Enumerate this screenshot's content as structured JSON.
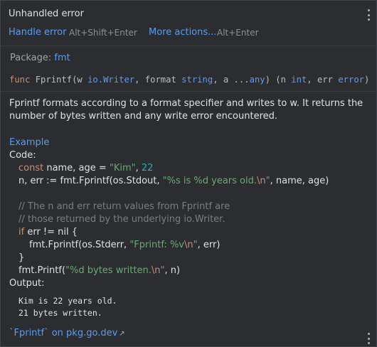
{
  "header": {
    "title": "Unhandled error",
    "actions": [
      {
        "label": "Handle error",
        "shortcut": "Alt+Shift+Enter"
      },
      {
        "label": "More actions...",
        "shortcut": "Alt+Enter"
      }
    ]
  },
  "package": {
    "label": "Package:",
    "name": "fmt"
  },
  "signature": {
    "func_kw": "func",
    "name": "Fprintf(w ",
    "w_type": "io.Writer",
    "mid1": ", format ",
    "format_type": "string",
    "mid2": ", a ...",
    "a_type": "any",
    "mid3": ") (n ",
    "n_type": "int",
    "mid4": ", err ",
    "err_type": "error",
    "end": ")"
  },
  "description": "Fprintf formats according to a format specifier and writes to w. It returns the number of bytes written and any write error encountered.",
  "example": {
    "link": "Example",
    "code_label": "Code:",
    "lines": {
      "l1": {
        "kw": "const",
        "a": " name, age = ",
        "s1": "\"Kim\"",
        "b": ", ",
        "n1": "22"
      },
      "l2": {
        "a": "n, err := fmt.Fprintf(os.Stdout, ",
        "s1": "\"%s is %d years old.",
        "esc": "\\n",
        "s2": "\"",
        "b": ", name, age)"
      },
      "l3": {
        "cmt": "// The n and err return values from Fprintf are"
      },
      "l4": {
        "cmt": "// those returned by the underlying io.Writer."
      },
      "l5": {
        "kw": "if",
        "a": " err != nil {"
      },
      "l6": {
        "a": "fmt.Fprintf(os.Stderr, ",
        "s1": "\"Fprintf: %v",
        "esc": "\\n",
        "s2": "\"",
        "b": ", err)"
      },
      "l7": {
        "a": "}"
      },
      "l8": {
        "a": "fmt.Printf(",
        "s1": "\"%d bytes written.",
        "esc": "\\n",
        "s2": "\"",
        "b": ", n)"
      }
    },
    "output_label": "Output:",
    "output": [
      "Kim is 22 years old.",
      "21 bytes written."
    ]
  },
  "footer": {
    "link": "`Fprintf` on pkg.go.dev",
    "arrow": "↗"
  }
}
